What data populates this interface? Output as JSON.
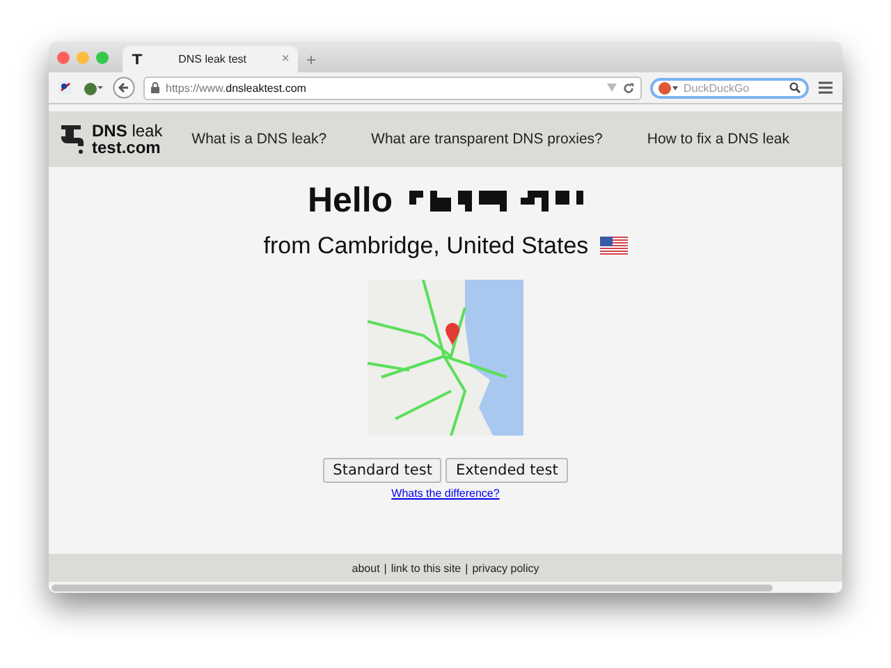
{
  "browser": {
    "tab": {
      "title": "DNS leak test",
      "close": "×"
    },
    "new_tab": "+",
    "url_prefix": "https://www.",
    "url_domain": "dnsleaktest.com",
    "search_placeholder": "DuckDuckGo"
  },
  "site": {
    "logo": {
      "line1": "DNS",
      "line1b": "leak",
      "line2": "test.com"
    },
    "nav": [
      "What is a DNS leak?",
      "What are transparent DNS proxies?",
      "How to fix a DNS leak"
    ]
  },
  "greeting": {
    "hello": "Hello",
    "location": "from Cambridge, United States"
  },
  "buttons": [
    "Standard test",
    "Extended test"
  ],
  "difference_link": "Whats the difference?",
  "footer": {
    "links": [
      "about",
      "link to this site",
      "privacy policy"
    ],
    "separator": "|"
  }
}
